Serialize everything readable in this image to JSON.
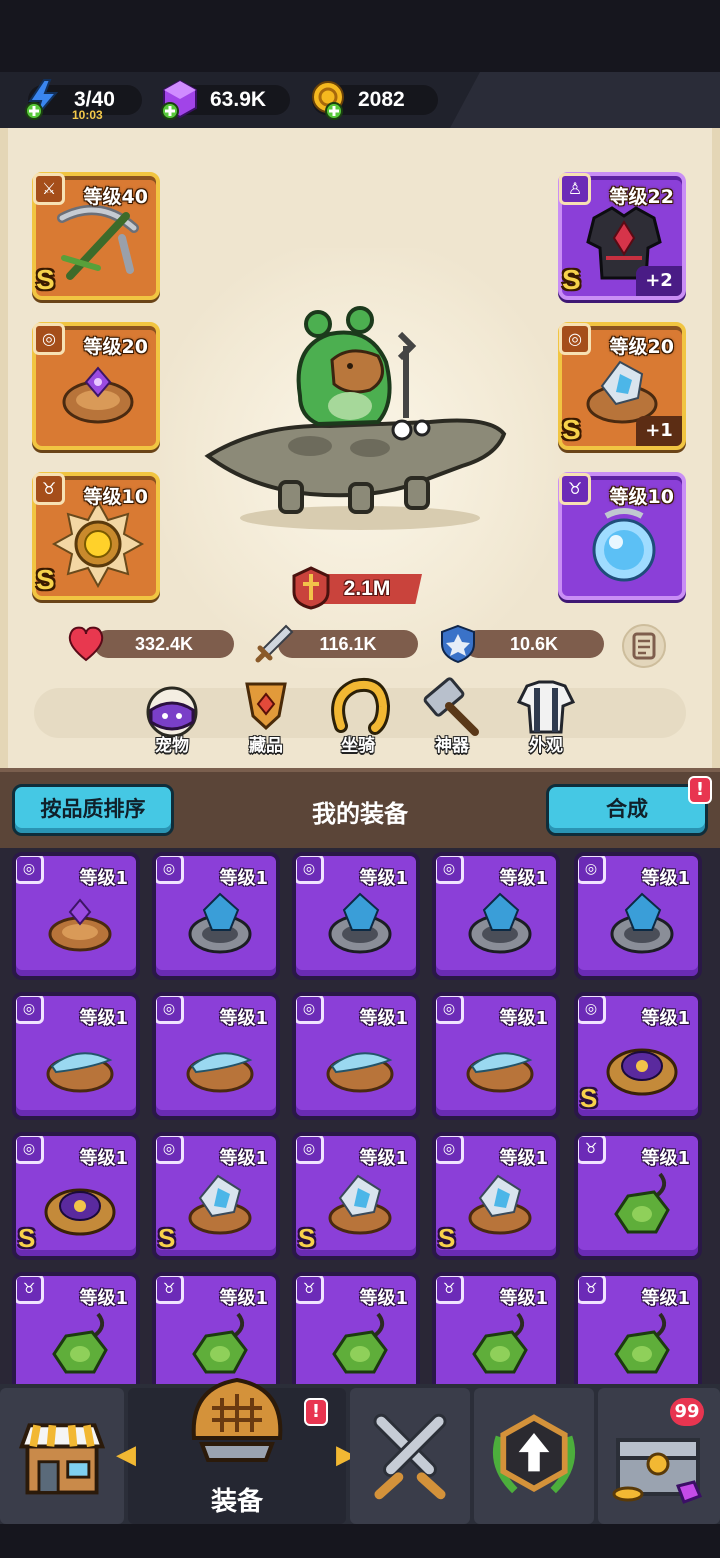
{
  "resources": {
    "energy": {
      "value": "3/40",
      "timer": "10:03",
      "icon": "lightning-plus-icon"
    },
    "gems": {
      "value": "63.9K",
      "icon": "purple-gem-plus-icon"
    },
    "coins": {
      "value": "2082",
      "icon": "gold-coin-plus-icon"
    }
  },
  "character": {
    "slots_left": [
      {
        "level": "等级40",
        "rank": "S",
        "type": "weapon",
        "icon": "crossbow-icon"
      },
      {
        "level": "等级20",
        "rank": "",
        "type": "ring",
        "icon": "ring-icon"
      },
      {
        "level": "等级10",
        "rank": "S",
        "type": "amulet",
        "icon": "sun-amulet-icon"
      }
    ],
    "slots_right": [
      {
        "level": "等级22",
        "rank": "S",
        "plus": "+2",
        "type": "armor",
        "icon": "armor-icon"
      },
      {
        "level": "等级20",
        "rank": "S",
        "plus": "+1",
        "type": "ring",
        "icon": "crystal-ring-icon"
      },
      {
        "level": "等级10",
        "rank": "",
        "type": "amulet",
        "icon": "orb-amulet-icon"
      }
    ],
    "power": "2.1M",
    "stats": {
      "hp": "332.4K",
      "attack": "116.1K",
      "defense": "10.6K"
    },
    "nav": [
      {
        "label": "宠物",
        "icon": "pet-egg-icon"
      },
      {
        "label": "藏品",
        "icon": "collection-trophy-icon"
      },
      {
        "label": "坐骑",
        "icon": "mount-horseshoe-icon"
      },
      {
        "label": "神器",
        "icon": "artifact-hammer-icon"
      },
      {
        "label": "外观",
        "icon": "outfit-icon"
      }
    ]
  },
  "equipment": {
    "sort_label": "按品质排序",
    "title": "我的装备",
    "merge_label": "合成",
    "merge_alert": "!",
    "items": [
      {
        "level": "等级1",
        "rank": "",
        "art": "amber-ring"
      },
      {
        "level": "等级1",
        "rank": "",
        "art": "blue-crystal-ring"
      },
      {
        "level": "等级1",
        "rank": "",
        "art": "blue-crystal-ring"
      },
      {
        "level": "等级1",
        "rank": "",
        "art": "blue-crystal-ring"
      },
      {
        "level": "等级1",
        "rank": "",
        "art": "blue-crystal-ring"
      },
      {
        "level": "等级1",
        "rank": "",
        "art": "wing-ring"
      },
      {
        "level": "等级1",
        "rank": "",
        "art": "wing-ring"
      },
      {
        "level": "等级1",
        "rank": "",
        "art": "wing-ring"
      },
      {
        "level": "等级1",
        "rank": "",
        "art": "wing-ring"
      },
      {
        "level": "等级1",
        "rank": "S",
        "art": "purple-gem-ring"
      },
      {
        "level": "等级1",
        "rank": "S",
        "art": "purple-gem-ring"
      },
      {
        "level": "等级1",
        "rank": "S",
        "art": "crystal-gold-ring"
      },
      {
        "level": "等级1",
        "rank": "S",
        "art": "crystal-gold-ring"
      },
      {
        "level": "等级1",
        "rank": "S",
        "art": "crystal-gold-ring"
      },
      {
        "level": "等级1",
        "rank": "",
        "art": "green-amulet"
      },
      {
        "level": "等级1",
        "rank": "",
        "art": "green-amulet"
      },
      {
        "level": "等级1",
        "rank": "",
        "art": "green-amulet"
      },
      {
        "level": "等级1",
        "rank": "",
        "art": "green-amulet"
      },
      {
        "level": "等级1",
        "rank": "",
        "art": "green-amulet"
      },
      {
        "level": "等级1",
        "rank": "",
        "art": "green-amulet"
      }
    ]
  },
  "bottom_nav": {
    "tabs": [
      {
        "label": "",
        "icon": "shop-icon"
      },
      {
        "label": "装备",
        "icon": "helmet-icon",
        "alert": "!"
      },
      {
        "label": "",
        "icon": "crossed-swords-icon"
      },
      {
        "label": "",
        "icon": "upgrade-arrow-icon"
      },
      {
        "label": "",
        "icon": "treasure-chest-icon",
        "badge": "99"
      }
    ]
  },
  "colors": {
    "epic": "#8b3fd8",
    "legendary": "#d97a33",
    "gold_border": "#f1c542",
    "button": "#45c8e4"
  }
}
